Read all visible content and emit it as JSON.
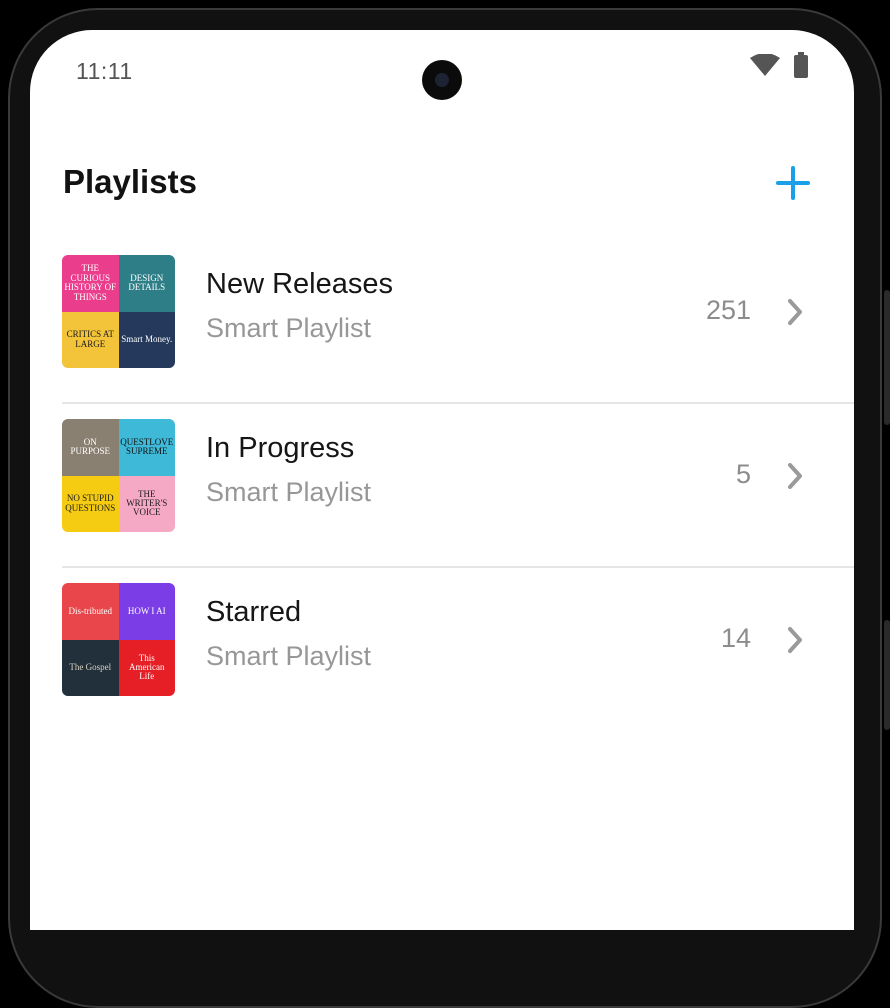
{
  "status_bar": {
    "time": "11:11",
    "icons": [
      "wifi-icon",
      "battery-icon"
    ]
  },
  "header": {
    "title": "Playlists",
    "add_icon": "plus-icon"
  },
  "colors": {
    "accent": "#1aa0e8",
    "title": "#121212",
    "subtitle": "#979797",
    "count": "#8c8c8c",
    "divider": "#e6e6e6"
  },
  "playlists": [
    {
      "title": "New Releases",
      "subtitle": "Smart Playlist",
      "count": "251",
      "artwork": [
        {
          "name": "the-curious-history-of-things-art",
          "text": "THE CURIOUS HISTORY OF THINGS",
          "bg": "#ea3d8c",
          "fg": "#ffffff"
        },
        {
          "name": "design-details-art",
          "text": "DESIGN DETAILS",
          "bg": "#2d7e86",
          "fg": "#ffffff"
        },
        {
          "name": "critics-at-large-art",
          "text": "CRITICS AT LARGE",
          "bg": "#f3c33a",
          "fg": "#1c1c1c"
        },
        {
          "name": "smart-money-art",
          "text": "Smart Money.",
          "bg": "#24395c",
          "fg": "#ffffff"
        }
      ]
    },
    {
      "title": "In Progress",
      "subtitle": "Smart Playlist",
      "count": "5",
      "artwork": [
        {
          "name": "on-purpose-art",
          "text": "ON PURPOSE",
          "bg": "#8a8072",
          "fg": "#ffffff"
        },
        {
          "name": "questlove-supreme-art",
          "text": "QUESTLOVE SUPREME",
          "bg": "#3fb9d8",
          "fg": "#111111"
        },
        {
          "name": "no-stupid-questions-art",
          "text": "NO STUPID QUESTIONS",
          "bg": "#f5cc12",
          "fg": "#1c1c1c"
        },
        {
          "name": "the-writers-voice-art",
          "text": "THE WRITER'S VOICE",
          "bg": "#f6a9c4",
          "fg": "#1c1c1c"
        }
      ]
    },
    {
      "title": "Starred",
      "subtitle": "Smart Playlist",
      "count": "14",
      "artwork": [
        {
          "name": "distributed-art",
          "text": "Dis-tributed",
          "bg": "#e8464a",
          "fg": "#ffffff"
        },
        {
          "name": "how-i-ai-art",
          "text": "HOW I AI",
          "bg": "#7b3ee6",
          "fg": "#ffffff"
        },
        {
          "name": "the-gospel-art",
          "text": "The Gospel",
          "bg": "#22303b",
          "fg": "#d9d2c3"
        },
        {
          "name": "this-american-life-art",
          "text": "This American Life",
          "bg": "#e61e25",
          "fg": "#ffffff"
        }
      ]
    }
  ]
}
